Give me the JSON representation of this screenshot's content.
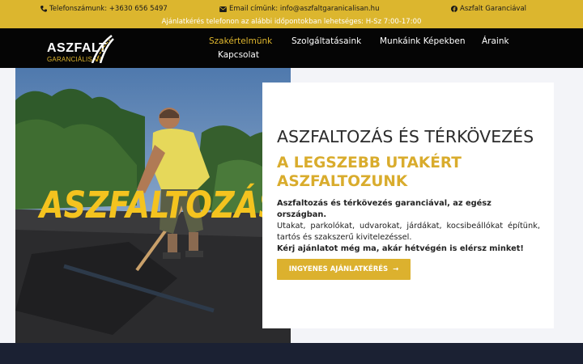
{
  "topbar": {
    "phone": "Telefonszámunk: +3630 656 5497",
    "email": "Email címünk: info@aszfaltgaranicalisan.hu",
    "facebook": "Aszfalt Garanciával",
    "hours": "Ajánlatkérés telefonon az alábbi időpontokban lehetséges: H-Sz 7:00-17:00"
  },
  "logo": {
    "line1": "ASZFALT",
    "line2": "GARANCIÁLISAN"
  },
  "nav": {
    "items": [
      {
        "label": "Szakértelmünk",
        "active": true
      },
      {
        "label": "Szolgáltatásaink"
      },
      {
        "label": "Munkáink Képekben"
      },
      {
        "label": "Áraink"
      },
      {
        "label": "Kapcsolat"
      }
    ]
  },
  "hero": {
    "image_text": "ASZFALTOZÁS",
    "title": "ASZFALTOZÁS ÉS TÉRKÖVEZÉS",
    "subtitle": "A LEGSZEBB UTAKÉRT ASZFALTOZUNK",
    "body_bold": "Aszfaltozás és térkövezés garanciával, az egész országban.",
    "body_text": "Utakat, parkolókat, udvarokat, járdákat, kocsibeállókat építünk, tartós és szakszerű kivitelezéssel.",
    "body_cta": "Kérj ajánlatot még ma, akár hétvégén is elérsz minket!",
    "button": "INGYENES AJÁNLATKÉRÉS",
    "button_arrow": "→"
  },
  "colors": {
    "accent": "#dcb62e",
    "dark": "#050505",
    "strip": "#1b2133"
  }
}
